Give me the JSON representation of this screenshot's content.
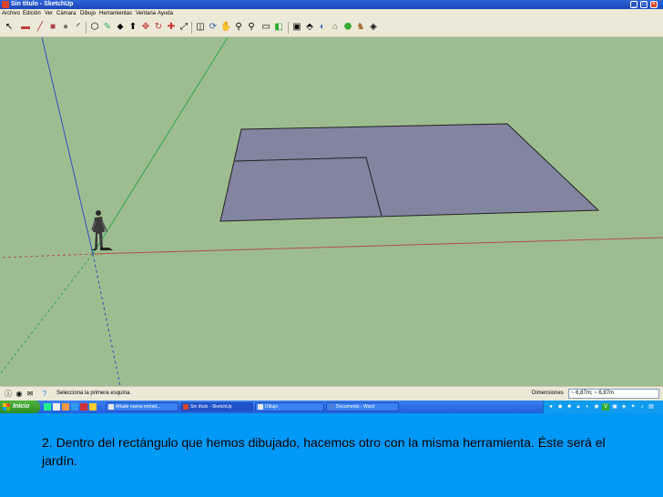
{
  "window": {
    "title": "Sin título - SketchUp"
  },
  "menu": [
    "Archivo",
    "Edición",
    "Ver",
    "Cámara",
    "Dibujo",
    "Herramientas",
    "Ventana",
    "Ayuda"
  ],
  "toolbar": {
    "icons": [
      "select-icon",
      "eraser-icon",
      "pencil-icon",
      "rectangle-icon",
      "circle-icon",
      "arc-icon",
      "polygon-icon",
      "freehand-icon",
      "paint-bucket-icon",
      "push-pull-icon",
      "move-icon",
      "rotate-icon",
      "follow-me-icon",
      "scale-icon",
      "offset-icon",
      "tape-measure-icon",
      "dimension-icon",
      "protractor-icon",
      "text-icon",
      "axes-icon",
      "3d-text-icon",
      "orbit-icon",
      "pan-icon",
      "zoom-icon",
      "zoom-window-icon",
      "zoom-extents-icon",
      "previous-view-icon",
      "next-view-icon",
      "walk-icon",
      "look-around-icon",
      "position-camera-icon",
      "section-plane-icon",
      "components-icon",
      "materials-icon",
      "google-earth-icon",
      "warehouse-icon",
      "get-models-icon",
      "share-model-icon"
    ]
  },
  "status": {
    "hint": "Selecciona la primera esquina.",
    "dimensions_label": "Dimensiones",
    "dimensions_value": "~ 6,87m; ~ 6,87m"
  },
  "taskbar": {
    "start_label": "Inicio",
    "tasks": [
      "Añade nueva entrad...",
      "Sin título - SketchUp",
      "Dibujo",
      "Documento - Word"
    ],
    "active_task_index": 1
  },
  "caption": {
    "text": "2. Dentro del rectángulo que hemos dibujado, hacemos otro con la misma herramienta. Éste será el jardín."
  },
  "colors": {
    "ground": "#9dbd90",
    "face": "#8285a0",
    "axis_red": "#b05050",
    "axis_green": "#2ea84a",
    "axis_blue": "#3050c0",
    "caption_bg": "#0099f7"
  }
}
